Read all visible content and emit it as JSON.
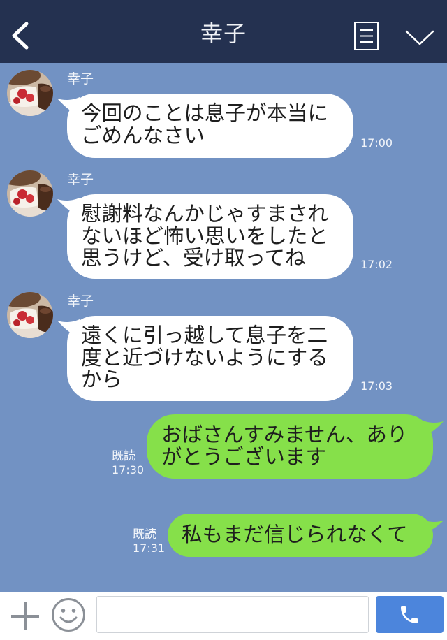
{
  "header": {
    "title": "幸子",
    "back_icon": "chevron-left-icon",
    "notes_icon": "list-icon",
    "menu_icon": "chevron-down-icon"
  },
  "colors": {
    "header_bg": "#243150",
    "chat_bg": "#7292c3",
    "received_bubble": "#ffffff",
    "sent_bubble": "#86e04a",
    "send_button": "#4c85dc",
    "footer_icon": "#8b9097"
  },
  "chat": {
    "received": [
      {
        "sender": "幸子",
        "lines": [
          "今回のことは息子が本当に",
          "ごめんなさい"
        ],
        "time": "17:00"
      },
      {
        "sender": "幸子",
        "lines": [
          "慰謝料なんかじゃすまされ",
          "ないほど怖い思いをしたと",
          "思うけど、受け取ってね"
        ],
        "time": "17:02"
      },
      {
        "sender": "幸子",
        "lines": [
          "遠くに引っ越して息子を二",
          "度と近づけないようにする",
          "から"
        ],
        "time": "17:03"
      }
    ],
    "sent": [
      {
        "lines": [
          "おばさんすみません、あり",
          "がとうございます"
        ],
        "read": "既読",
        "time": "17:30"
      },
      {
        "lines": [
          "私もまだ信じられなくて"
        ],
        "read": "既読",
        "time": "17:31"
      }
    ]
  },
  "input_bar": {
    "add_icon": "plus-icon",
    "emoji_icon": "smiley-icon",
    "message": "",
    "send_icon": "phone-icon"
  }
}
